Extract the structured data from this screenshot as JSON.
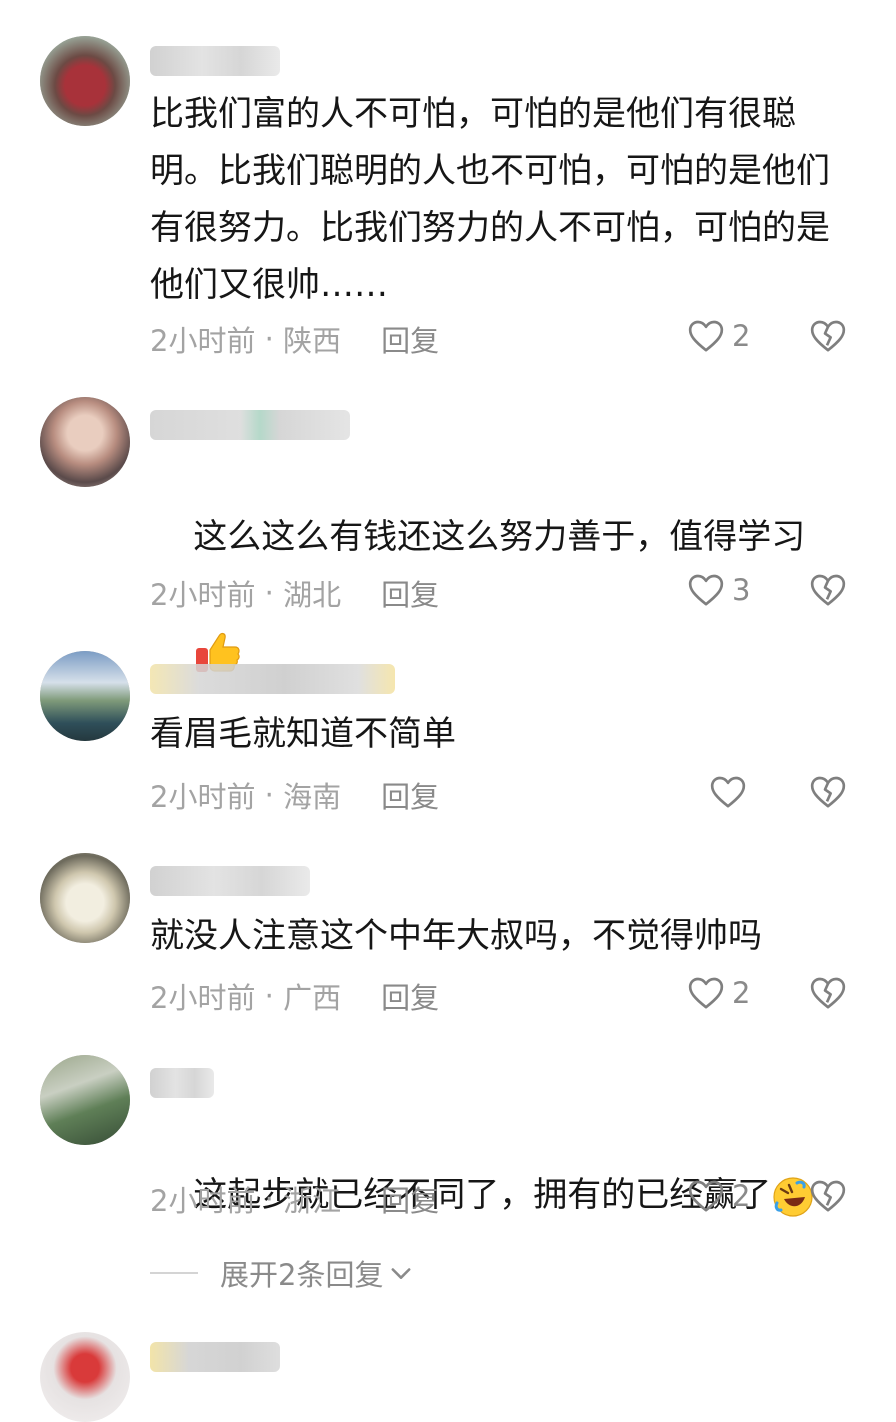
{
  "comments": [
    {
      "text": "比我们富的人不可怕，可怕的是他们有很聪明。比我们聪明的人也不可怕，可怕的是他们有很努力。比我们努力的人不可怕，可怕的是他们又很帅……",
      "time": "2小时前",
      "location": "陕西",
      "reply": "回复",
      "likes": "2"
    },
    {
      "text": "这么这么有钱还这么努力善于，值得学习",
      "emoji": "thumbs-up",
      "time": "2小时前",
      "location": "湖北",
      "reply": "回复",
      "likes": "3"
    },
    {
      "text": "看眉毛就知道不简单",
      "time": "2小时前",
      "location": "海南",
      "reply": "回复",
      "likes": ""
    },
    {
      "text": "就没人注意这个中年大叔吗，不觉得帅吗",
      "time": "2小时前",
      "location": "广西",
      "reply": "回复",
      "likes": "2"
    },
    {
      "text": "这起步就已经不同了，拥有的已经赢了",
      "emoji": "rolling-laughing",
      "time": "2小时前",
      "location": "浙江",
      "reply": "回复",
      "likes": "2"
    }
  ],
  "expand_replies": "展开2条回复",
  "colors": {
    "text": "#161616",
    "meta": "#a3a3a3",
    "icon": "#7f7f7f"
  },
  "icons": {
    "like": "heart-outline-icon",
    "dislike": "broken-heart-icon",
    "expand": "chevron-down-icon"
  }
}
